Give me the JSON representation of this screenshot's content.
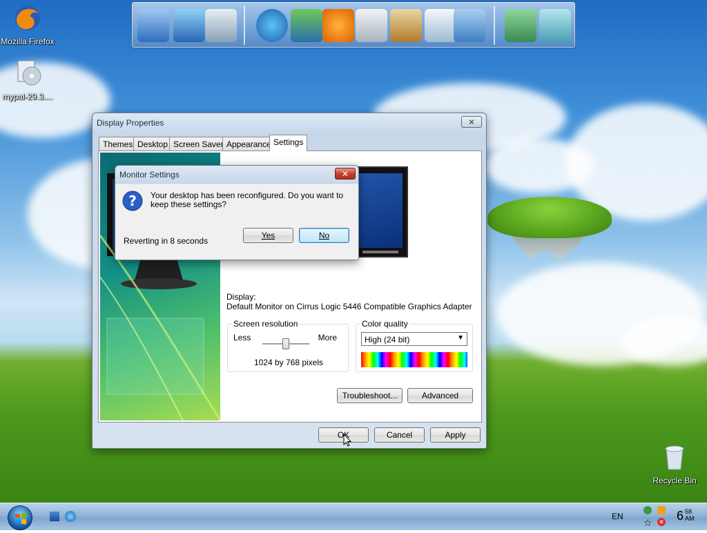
{
  "desktop": {
    "icons": [
      {
        "label": "Mozilla Firefox",
        "icon": "firefox-icon"
      },
      {
        "label": "mypal-29.3....",
        "icon": "installer-icon"
      },
      {
        "label": "Recycle Bin",
        "icon": "recycle-bin-icon"
      }
    ]
  },
  "dock": {
    "items": [
      "computer-icon",
      "network-icon",
      "documents-icon",
      "internet-explorer-icon",
      "media-center-icon",
      "media-player-icon",
      "calculator-icon",
      "paint-icon",
      "notepad-icon",
      "control-panel-icon",
      "tools-icon",
      "recycle-icon"
    ]
  },
  "display_properties": {
    "title": "Display Properties",
    "tabs": [
      "Themes",
      "Desktop",
      "Screen Saver",
      "Appearance",
      "Settings"
    ],
    "active_tab": "Settings",
    "display_label": "Display:",
    "display_value": "Default Monitor on Cirrus Logic 5446 Compatible Graphics Adapter",
    "screen_resolution": {
      "label": "Screen resolution",
      "less": "Less",
      "more": "More",
      "value": "1024 by 768 pixels",
      "slider_position": 0.5
    },
    "color_quality": {
      "label": "Color quality",
      "selected": "High (24 bit)"
    },
    "buttons": {
      "troubleshoot": "Troubleshoot...",
      "advanced": "Advanced",
      "ok": "OK",
      "cancel": "Cancel",
      "apply": "Apply"
    }
  },
  "monitor_settings": {
    "title": "Monitor Settings",
    "message": "Your desktop has been reconfigured.  Do you want to keep these settings?",
    "reverting": "Reverting in 8 seconds",
    "yes": "Yes",
    "no": "No"
  },
  "taskbar": {
    "language": "EN",
    "time": "6",
    "time_min": "58",
    "time_ampm": "AM"
  },
  "colors": {
    "accent": "#3c7fb1",
    "close_red": "#c4422c"
  }
}
